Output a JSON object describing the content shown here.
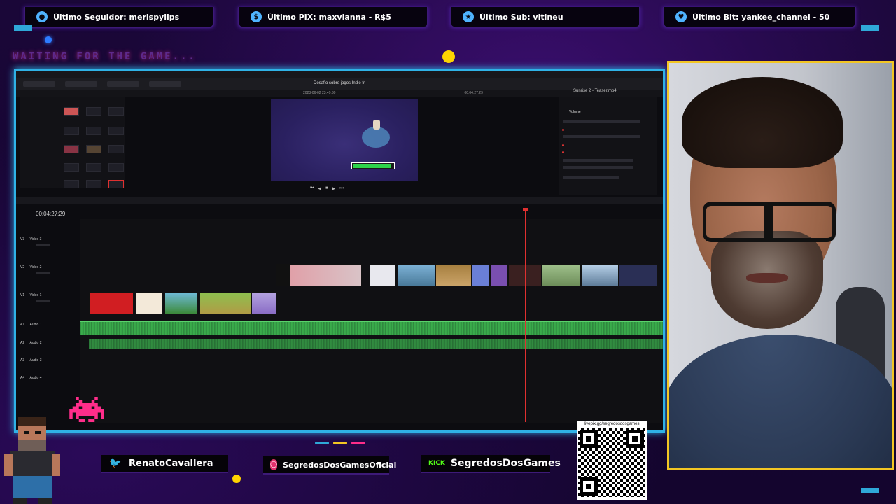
{
  "top_bars": [
    {
      "label": "Último Seguidor: merispylips",
      "icon": "person-icon",
      "color": "#4fb3ff"
    },
    {
      "label": "Último PIX: maxvianna - R$5",
      "icon": "dollar-icon",
      "color": "#4fb3ff"
    },
    {
      "label": "Último Sub: vitineu",
      "icon": "star-icon",
      "color": "#4fb3ff"
    },
    {
      "label": "Último Bit: yankee_channel - 50",
      "icon": "heart-icon",
      "color": "#4fb3ff"
    }
  ],
  "waiting_text": "WAITING FOR THE GAME...",
  "editor": {
    "project_title": "Desafio sobre jogos Indie fr",
    "date_line": "2023-06-02 23:49:30",
    "timecode": "00:04:27:29",
    "viewer_timecode": "00:04:27:29",
    "inspector_title": "Sunrise 2 - Teaser.mp4",
    "inspector_section": "Volume",
    "tracks_video": [
      {
        "id": "V3",
        "name": "Video 3"
      },
      {
        "id": "V2",
        "name": "Video 2"
      },
      {
        "id": "V1",
        "name": "Video 1"
      }
    ],
    "tracks_audio": [
      {
        "id": "A1",
        "name": "Audio 1"
      },
      {
        "id": "A2",
        "name": "Audio 2"
      },
      {
        "id": "A3",
        "name": "Audio 3"
      },
      {
        "id": "A4",
        "name": "Audio 4"
      }
    ],
    "viewer_progress": 0.95
  },
  "socials": [
    {
      "label": "RenatoCavallera",
      "icon": "twitter-icon",
      "color": "#1da1f2"
    },
    {
      "label": "SegredosDosGamesOficial",
      "icon": "instagram-icon",
      "color": "#e1306c"
    },
    {
      "label": "SegredosDosGames",
      "icon": "kick-icon",
      "color": "#53fc18",
      "icon_text": "KICK"
    }
  ],
  "qr_url": "livepix.gg/segredosdosgames",
  "colors": {
    "frame": "#2fb2e6",
    "webcam_border": "#f3c623",
    "accent_purple": "#3d1a78",
    "audio_green": "#3db64f",
    "playhead": "#e03030"
  }
}
